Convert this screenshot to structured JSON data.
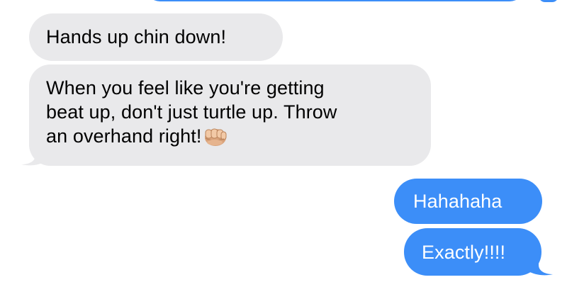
{
  "messages": [
    {
      "direction": "received",
      "text": "Hands up chin down!"
    },
    {
      "direction": "received",
      "lines": [
        "When you feel like you're getting",
        "beat up, don't just turtle up. Throw",
        "an overhand right!"
      ],
      "emoji": "oncoming-fist-icon"
    },
    {
      "direction": "sent",
      "text": "Hahahaha"
    },
    {
      "direction": "sent",
      "text": "Exactly!!!!"
    }
  ],
  "colors": {
    "sent_bubble": "#3c8ef8",
    "received_bubble": "#e9e9eb",
    "sent_text": "#ffffff",
    "received_text": "#000000"
  }
}
